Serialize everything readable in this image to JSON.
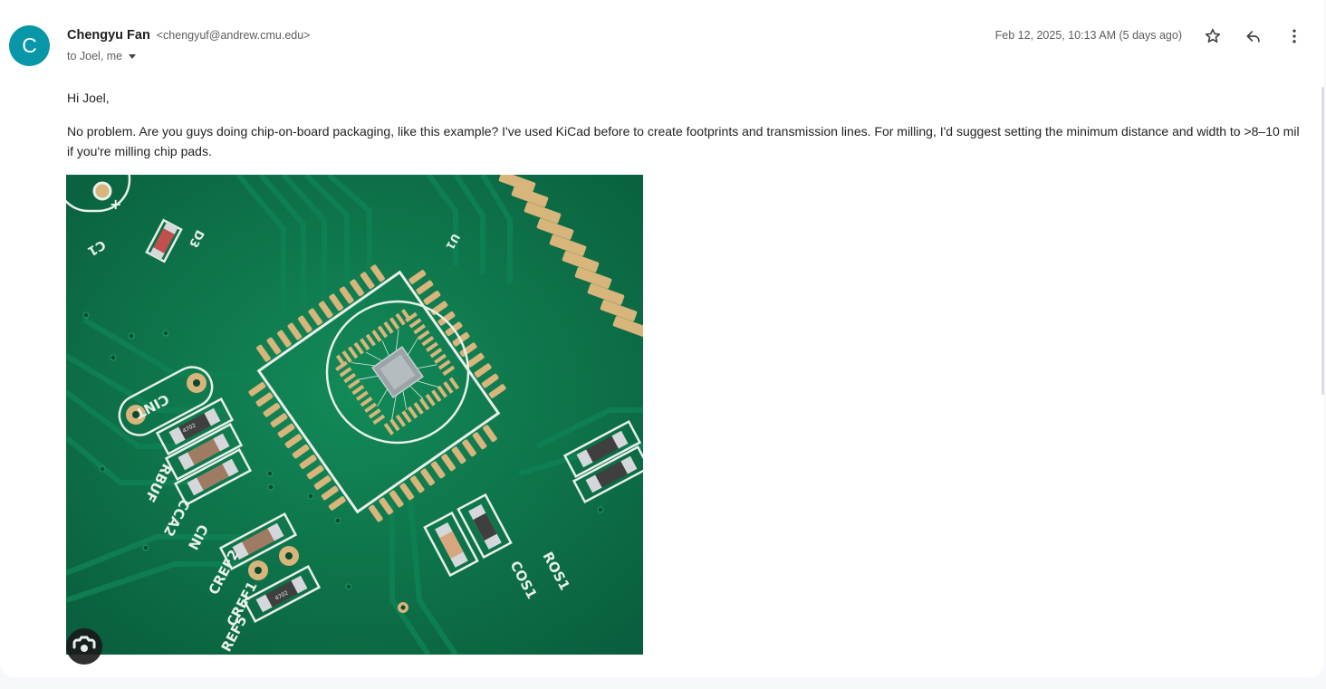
{
  "email": {
    "avatar_letter": "C",
    "sender_name": "Chengyu Fan",
    "sender_email": "<chengyuf@andrew.cmu.edu>",
    "recipients": "to Joel, me",
    "date": "Feb 12, 2025, 10:13 AM (5 days ago)",
    "greeting": "Hi Joel,",
    "body": "No problem. Are you guys doing chip-on-board packaging, like this example? I've used KiCad before to create footprints and transmission lines. For milling, I'd suggest setting the minimum distance and width to >8–10 mil if you're milling chip pads."
  },
  "actions": {
    "star_icon": "star-icon",
    "reply_icon": "reply-icon",
    "more_icon": "more-vert-icon"
  },
  "pcb_labels": {
    "c1": "C1",
    "d3": "D3",
    "u1": "U1",
    "cint": "CINT",
    "rbuf": "RBUF",
    "cca2": "CCA2",
    "cin": "CIN",
    "cref2": "CREF2",
    "cref1": "CREF1",
    "ref5": "REF5",
    "cos1": "COS1",
    "ros1": "ROS1",
    "plus": "+",
    "res_code": "4702"
  },
  "colors": {
    "avatar_bg": "#0797a8",
    "pcb_green": "#0c6e46",
    "pad_gold": "#d8b57a"
  }
}
